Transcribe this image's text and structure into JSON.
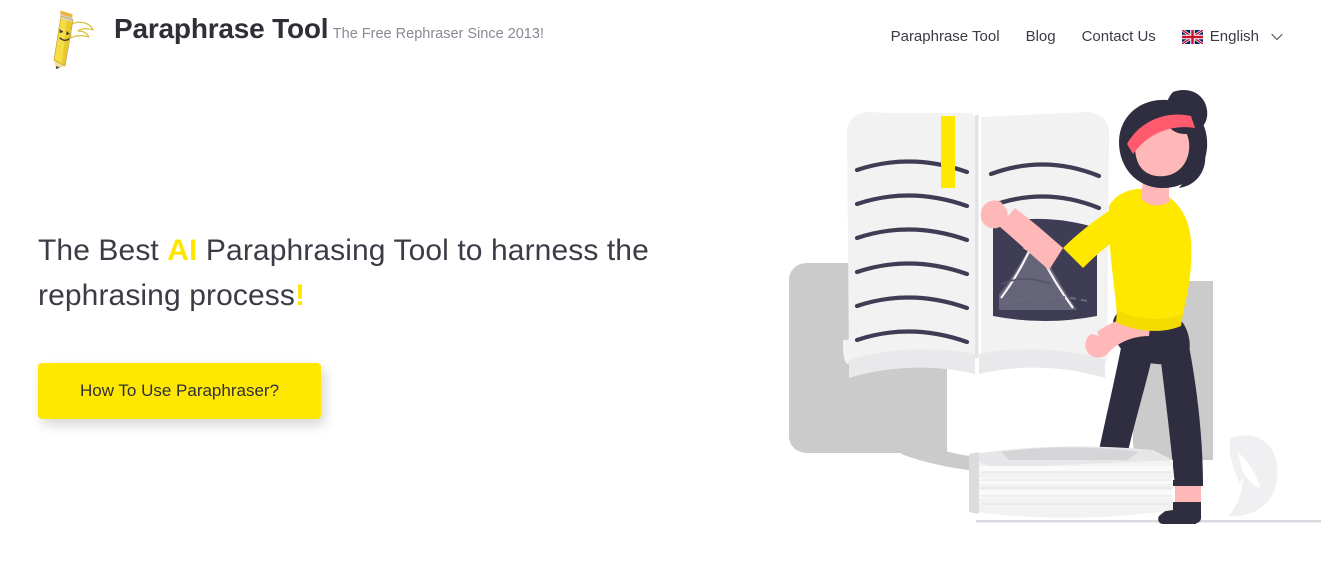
{
  "header": {
    "brand": {
      "title": "Paraphrase Tool",
      "tagline": "The Free Rephraser Since 2013!",
      "logo_icon": "winged-pencil-mascot-icon"
    },
    "nav": [
      {
        "label": "Paraphrase Tool"
      },
      {
        "label": "Blog"
      },
      {
        "label": "Contact Us"
      }
    ],
    "language": {
      "label": "English",
      "flag_icon": "uk-flag-icon",
      "chevron_icon": "chevron-down-icon"
    }
  },
  "hero": {
    "heading_part1": "The Best ",
    "heading_highlight": "AI",
    "heading_part2": " Paraphrasing Tool to harness the rephrasing process",
    "heading_bang": "!",
    "cta_label": "How To Use Paraphraser?",
    "illustration": "woman-reading-open-book-illustration"
  },
  "colors": {
    "accent_yellow": "#ffe800",
    "heading_text": "#3c3c46",
    "body_text": "#3b3b45",
    "muted_text": "#8a8a95",
    "illustration_navy": "#2f2e41",
    "illustration_skin": "#ffb8b8",
    "illustration_gray": "#cccccc",
    "illustration_paper": "#f2f2f2",
    "illustration_headband": "#ff5a6e",
    "background": "#ffffff"
  }
}
